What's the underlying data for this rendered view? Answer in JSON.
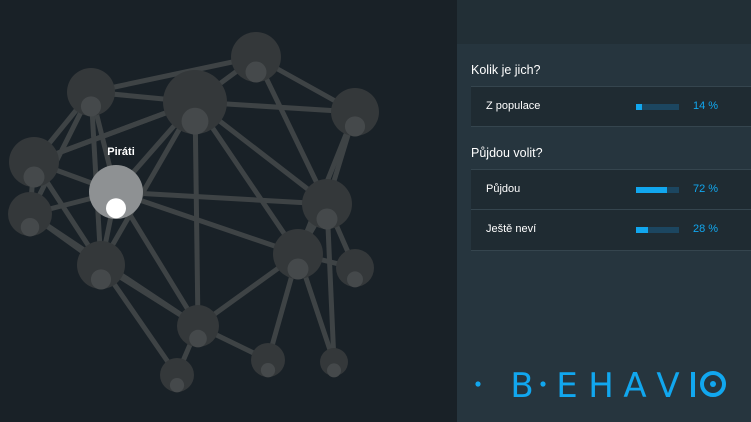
{
  "graph": {
    "highlighted_label": "Piráti"
  },
  "sections": [
    {
      "title": "Kolik je jich?",
      "rows": [
        {
          "label": "Z populace",
          "value_text": "14 %",
          "fraction": 0.14
        }
      ]
    },
    {
      "title": "Půjdou volit?",
      "rows": [
        {
          "label": "Půjdou",
          "value_text": "72 %",
          "fraction": 0.72
        },
        {
          "label": "Ještě neví",
          "value_text": "28 %",
          "fraction": 0.28
        }
      ]
    }
  ],
  "brand": {
    "logo_text": "BEHAVIO",
    "color": "#11a7ef"
  }
}
